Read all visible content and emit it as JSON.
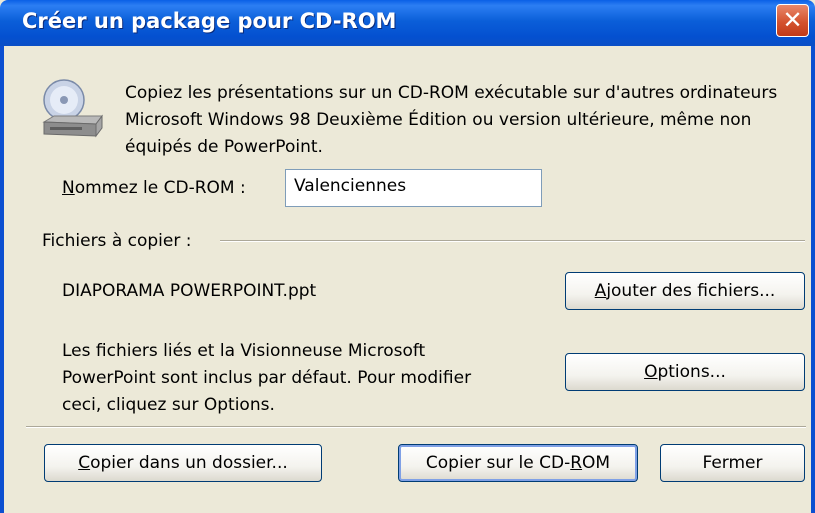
{
  "window": {
    "title": "Créer un package pour CD-ROM",
    "close_glyph": "✕"
  },
  "description": "Copiez les présentations sur un CD-ROM exécutable sur d'autres ordinateurs Microsoft Windows 98 Deuxième Édition ou version ultérieure, même non équipés de PowerPoint.",
  "cd_name": {
    "label_mnemonic": "N",
    "label_rest": "ommez le CD-ROM :",
    "value": "Valenciennes"
  },
  "files_section": {
    "label": "Fichiers à copier :",
    "file": "DIAPORAMA POWERPOINT.ppt"
  },
  "linked_note": {
    "line1": "Les fichiers liés et la Visionneuse Microsoft",
    "line2": "PowerPoint sont inclus par défaut. Pour modifier",
    "line3": "ceci, cliquez sur Options."
  },
  "buttons": {
    "add_files": {
      "mnemonic": "A",
      "rest": "jouter des fichiers..."
    },
    "options": {
      "mnemonic": "O",
      "rest": "ptions..."
    },
    "copy_folder": {
      "mnemonic": "C",
      "rest": "opier dans un dossier..."
    },
    "copy_cd": {
      "pre": "Copier sur le CD-",
      "mnemonic": "R",
      "post": "OM"
    },
    "close": {
      "label": "Fermer"
    }
  },
  "icons": {
    "dialog_icon": "cd-drive-icon",
    "close": "close-icon"
  }
}
